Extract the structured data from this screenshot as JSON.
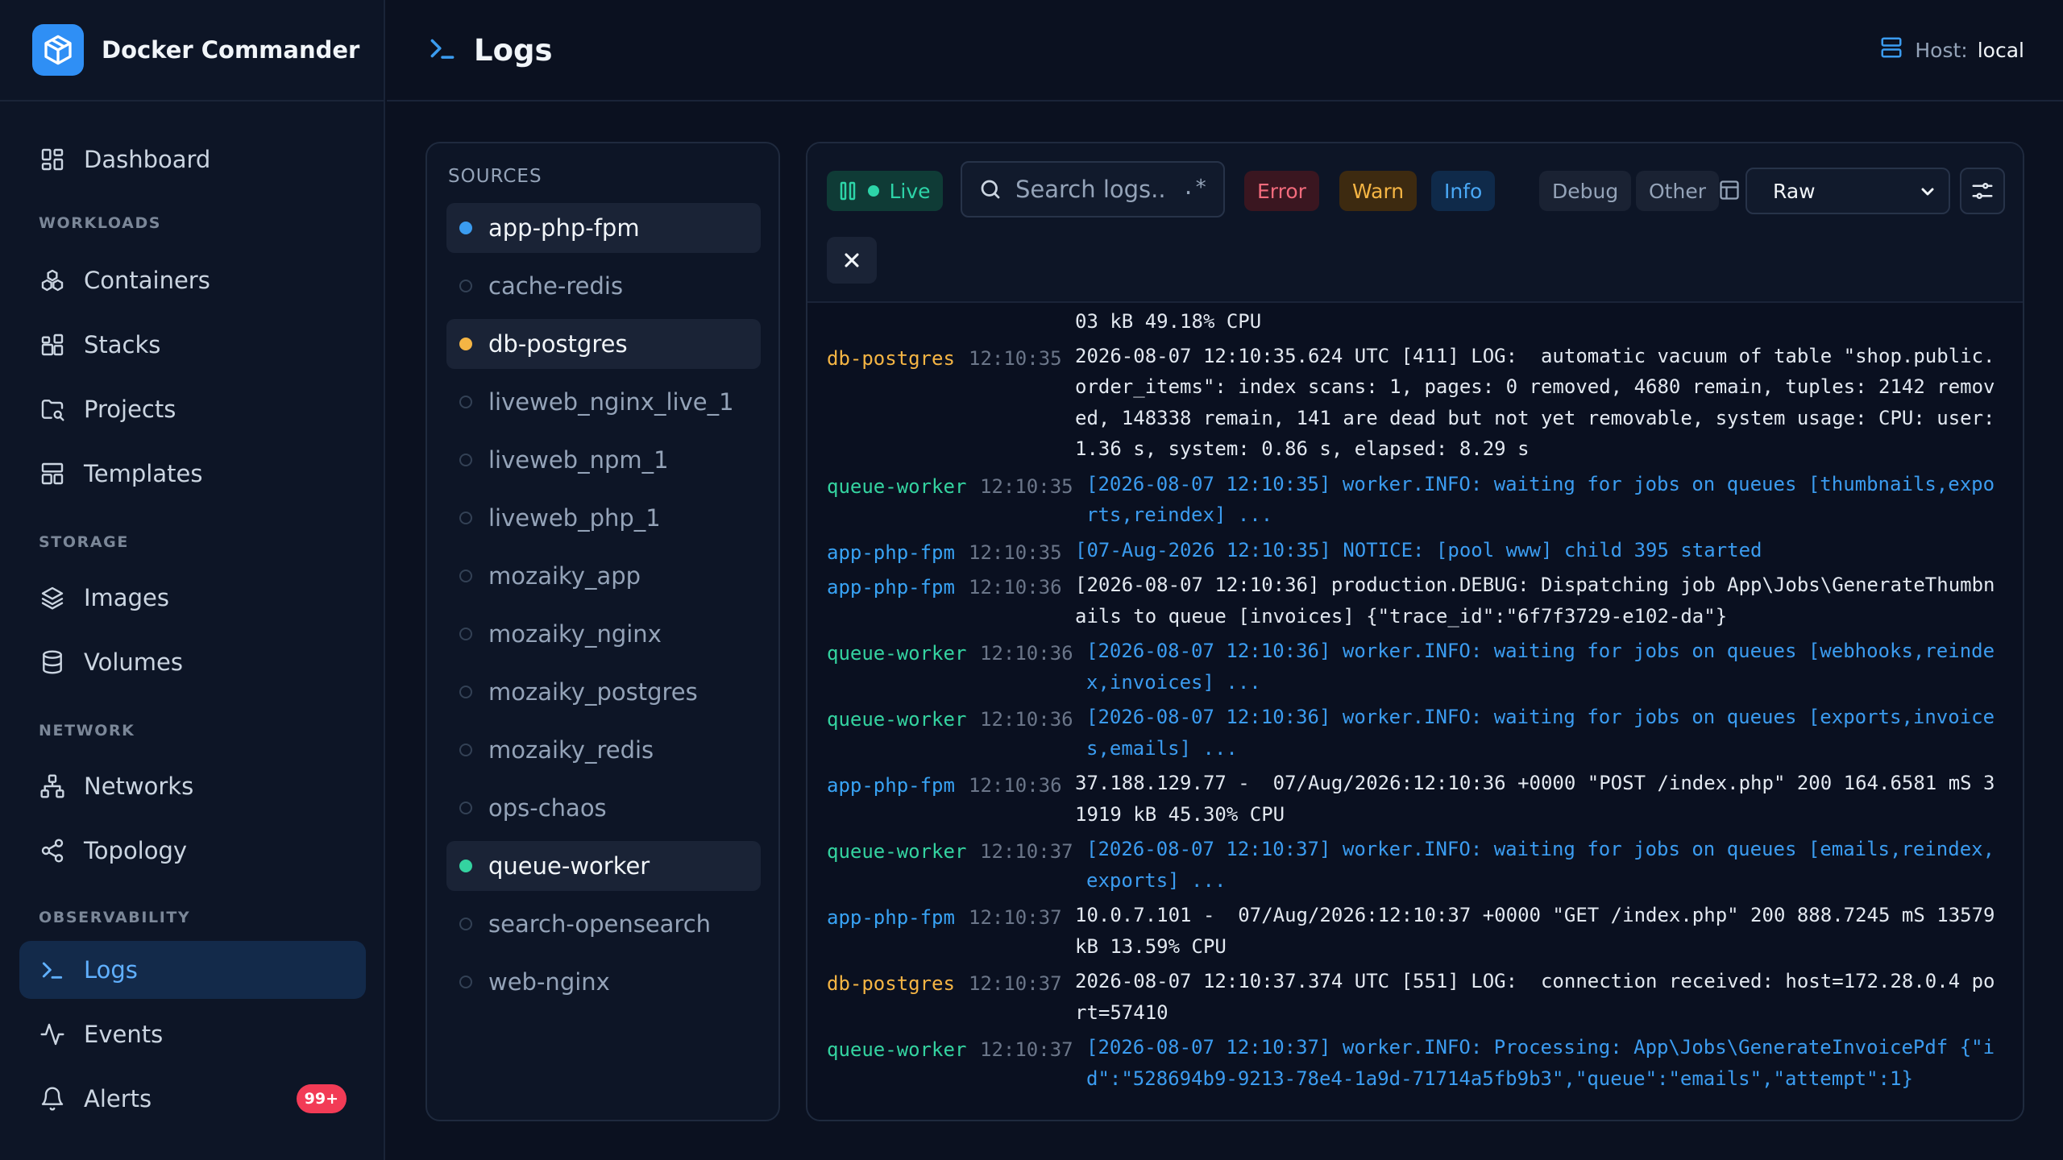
{
  "app": {
    "name": "Docker Commander"
  },
  "header": {
    "title": "Logs",
    "host_label": "Host:",
    "host_value": "local"
  },
  "nav": {
    "items": [
      {
        "label": "Dashboard",
        "icon": "dashboard-icon"
      },
      {
        "section": "WORKLOADS"
      },
      {
        "label": "Containers",
        "icon": "containers-icon"
      },
      {
        "label": "Stacks",
        "icon": "stacks-icon"
      },
      {
        "label": "Projects",
        "icon": "projects-icon"
      },
      {
        "label": "Templates",
        "icon": "templates-icon"
      },
      {
        "section": "STORAGE"
      },
      {
        "label": "Images",
        "icon": "layers-icon"
      },
      {
        "label": "Volumes",
        "icon": "database-icon"
      },
      {
        "section": "NETWORK"
      },
      {
        "label": "Networks",
        "icon": "network-icon"
      },
      {
        "label": "Topology",
        "icon": "share-icon"
      },
      {
        "section": "OBSERVABILITY"
      },
      {
        "label": "Logs",
        "icon": "terminal-icon",
        "active": true
      },
      {
        "label": "Events",
        "icon": "activity-icon"
      },
      {
        "label": "Alerts",
        "icon": "bell-icon",
        "badge": "99+"
      }
    ]
  },
  "sources": {
    "title": "SOURCES",
    "items": [
      {
        "name": "app-php-fpm",
        "selected": true,
        "color": "#3b9cf0"
      },
      {
        "name": "cache-redis",
        "selected": false
      },
      {
        "name": "db-postgres",
        "selected": true,
        "color": "#f5b544"
      },
      {
        "name": "liveweb_nginx_live_1",
        "selected": false
      },
      {
        "name": "liveweb_npm_1",
        "selected": false
      },
      {
        "name": "liveweb_php_1",
        "selected": false
      },
      {
        "name": "mozaiky_app",
        "selected": false
      },
      {
        "name": "mozaiky_nginx",
        "selected": false
      },
      {
        "name": "mozaiky_postgres",
        "selected": false
      },
      {
        "name": "mozaiky_redis",
        "selected": false
      },
      {
        "name": "ops-chaos",
        "selected": false
      },
      {
        "name": "queue-worker",
        "selected": true,
        "color": "#34d3a0"
      },
      {
        "name": "search-opensearch",
        "selected": false
      },
      {
        "name": "web-nginx",
        "selected": false
      }
    ]
  },
  "toolbar": {
    "live_label": "Live",
    "search_placeholder": "Search logs..",
    "regex_label": ".*",
    "levels": [
      {
        "label": "Error",
        "bg": "#3a1620",
        "fg": "#f26b7c"
      },
      {
        "label": "Warn",
        "bg": "#3d2a10",
        "fg": "#f5b544"
      },
      {
        "label": "Info",
        "bg": "#0f2a4a",
        "fg": "#4aa8f5"
      },
      {
        "label": "Debug",
        "bg": "#1a2233",
        "fg": "#94a3b8"
      },
      {
        "label": "Other",
        "bg": "#1a2233",
        "fg": "#94a3b8"
      }
    ],
    "view_mode": "Raw"
  },
  "logs": [
    {
      "src": "",
      "ts": "",
      "kind": "pg",
      "msg": "03 kB 49.18% CPU",
      "style": "plain",
      "lines": 1
    },
    {
      "src": "db-postgres",
      "ts": "12:10:35",
      "kind": "pg",
      "style": "plain",
      "lines": 4,
      "msg": "2026-08-07 12:10:35.624 UTC [411] LOG:  automatic vacuum of table \"shop.public.\norder_items\": index scans: 1, pages: 0 removed, 4680 remain, tuples: 2142 remov\ned, 148338 remain, 141 are dead but not yet removable, system usage: CPU: user:\n1.36 s, system: 0.86 s, elapsed: 8.29 s"
    },
    {
      "src": "queue-worker",
      "ts": "12:10:35",
      "kind": "qw",
      "style": "info",
      "lines": 2,
      "msg": "[2026-08-07 12:10:35] worker.INFO: waiting for jobs on queues [thumbnails,expo\nrts,reindex] ..."
    },
    {
      "src": "app-php-fpm",
      "ts": "12:10:35",
      "kind": "php",
      "style": "info",
      "lines": 1,
      "msg": "[07-Aug-2026 12:10:35] NOTICE: [pool www] child 395 started"
    },
    {
      "src": "app-php-fpm",
      "ts": "12:10:36",
      "kind": "php",
      "style": "plain",
      "lines": 2,
      "msg": "[2026-08-07 12:10:36] production.DEBUG: Dispatching job App\\Jobs\\GenerateThumbn\nails to queue [invoices] {\"trace_id\":\"6f7f3729-e102-da\"}"
    },
    {
      "src": "queue-worker",
      "ts": "12:10:36",
      "kind": "qw",
      "style": "info",
      "lines": 2,
      "msg": "[2026-08-07 12:10:36] worker.INFO: waiting for jobs on queues [webhooks,reinde\nx,invoices] ..."
    },
    {
      "src": "queue-worker",
      "ts": "12:10:36",
      "kind": "qw",
      "style": "info",
      "lines": 2,
      "msg": "[2026-08-07 12:10:36] worker.INFO: waiting for jobs on queues [exports,invoice\ns,emails] ..."
    },
    {
      "src": "app-php-fpm",
      "ts": "12:10:36",
      "kind": "php",
      "style": "plain",
      "lines": 2,
      "msg": "37.188.129.77 -  07/Aug/2026:12:10:36 +0000 \"POST /index.php\" 200 164.6581 mS 3\n1919 kB 45.30% CPU"
    },
    {
      "src": "queue-worker",
      "ts": "12:10:37",
      "kind": "qw",
      "style": "info",
      "lines": 2,
      "msg": "[2026-08-07 12:10:37] worker.INFO: waiting for jobs on queues [emails,reindex,\nexports] ..."
    },
    {
      "src": "app-php-fpm",
      "ts": "12:10:37",
      "kind": "php",
      "style": "plain",
      "lines": 2,
      "msg": "10.0.7.101 -  07/Aug/2026:12:10:37 +0000 \"GET /index.php\" 200 888.7245 mS 13579\nkB 13.59% CPU"
    },
    {
      "src": "db-postgres",
      "ts": "12:10:37",
      "kind": "pg",
      "style": "plain",
      "lines": 2,
      "msg": "2026-08-07 12:10:37.374 UTC [551] LOG:  connection received: host=172.28.0.4 po\nrt=57410"
    },
    {
      "src": "queue-worker",
      "ts": "12:10:37",
      "kind": "qw",
      "style": "info",
      "lines": 2,
      "msg": "[2026-08-07 12:10:37] worker.INFO: Processing: App\\Jobs\\GenerateInvoicePdf {\"i\nd\":\"528694b9-9213-78e4-1a9d-71714a5fb9b3\",\"queue\":\"emails\",\"attempt\":1}"
    }
  ]
}
